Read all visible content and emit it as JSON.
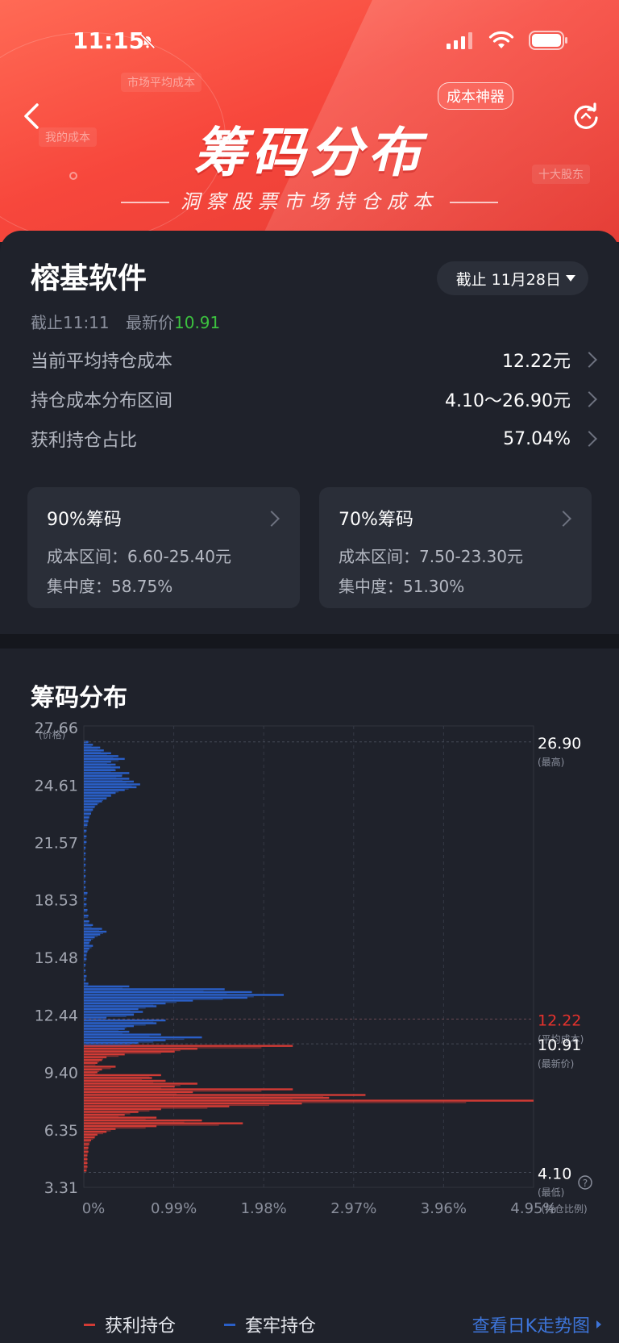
{
  "status_bar": {
    "time": "11:15"
  },
  "header": {
    "title": "筹码分布",
    "subtitle": "洞察股票市场持仓成本",
    "badge": "成本神器",
    "ghost_labels": [
      "市场平均成本",
      "我的成本",
      "十大股东"
    ]
  },
  "stock": {
    "name": "榕基软件",
    "date_selector": "截止 11月28日",
    "as_of_label": "截止11:11",
    "latest_price_label": "最新价",
    "latest_price": "10.91"
  },
  "metrics": [
    {
      "label": "当前平均持仓成本",
      "value": "12.22元"
    },
    {
      "label": "持仓成本分布区间",
      "value": "4.10～26.90元"
    },
    {
      "label": "获利持仓占比",
      "value": "57.04%"
    }
  ],
  "concentration": [
    {
      "title": "90%筹码",
      "range": "成本区间：6.60-25.40元",
      "degree": "集中度：58.75%"
    },
    {
      "title": "70%筹码",
      "range": "成本区间：7.50-23.30元",
      "degree": "集中度：51.30%"
    }
  ],
  "chart_section_title": "筹码分布",
  "chart_data": {
    "type": "bar",
    "orientation": "horizontal",
    "y_axis_label": "(价格)",
    "x_axis_label": "(持仓比例)",
    "y_ticks": [
      "27.66",
      "24.61",
      "21.57",
      "18.53",
      "15.48",
      "12.44",
      "9.40",
      "6.35",
      "3.31"
    ],
    "x_ticks": [
      "0%",
      "0.99%",
      "1.98%",
      "2.97%",
      "3.96%",
      "4.95%"
    ],
    "ylim": [
      3.31,
      27.66
    ],
    "xlim": [
      0,
      4.95
    ],
    "markers": [
      {
        "value": "26.90",
        "note": "(最高)",
        "price": 26.9,
        "color": "#ffffff"
      },
      {
        "value": "12.22",
        "note": "(平均成本)",
        "price": 12.22,
        "color": "#e5322d"
      },
      {
        "value": "10.91",
        "note": "(最新价)",
        "price": 10.91,
        "color": "#ffffff"
      },
      {
        "value": "4.10",
        "note": "(最低)",
        "price": 4.1,
        "color": "#ffffff"
      }
    ],
    "series": [
      {
        "name": "获利持仓",
        "color": "#d23b35",
        "price_range": [
          4.1,
          10.91
        ],
        "points": [
          [
            10.8,
            2.3
          ],
          [
            10.65,
            1.25
          ],
          [
            10.5,
            1.0
          ],
          [
            10.35,
            0.45
          ],
          [
            10.2,
            0.25
          ],
          [
            10.05,
            0.2
          ],
          [
            9.9,
            0.15
          ],
          [
            9.7,
            0.35
          ],
          [
            9.55,
            0.2
          ],
          [
            9.4,
            0.15
          ],
          [
            9.25,
            0.85
          ],
          [
            9.1,
            0.75
          ],
          [
            8.95,
            0.9
          ],
          [
            8.8,
            1.25
          ],
          [
            8.65,
            1.0
          ],
          [
            8.5,
            2.3
          ],
          [
            8.35,
            1.2
          ],
          [
            8.2,
            3.1
          ],
          [
            8.05,
            2.7
          ],
          [
            7.9,
            4.95
          ],
          [
            7.75,
            2.4
          ],
          [
            7.6,
            1.6
          ],
          [
            7.45,
            0.85
          ],
          [
            7.3,
            0.6
          ],
          [
            7.15,
            0.45
          ],
          [
            7.0,
            0.8
          ],
          [
            6.85,
            1.3
          ],
          [
            6.7,
            1.75
          ],
          [
            6.55,
            0.8
          ],
          [
            6.4,
            0.35
          ],
          [
            6.25,
            0.25
          ],
          [
            6.1,
            0.15
          ],
          [
            5.95,
            0.12
          ],
          [
            5.8,
            0.08
          ],
          [
            5.6,
            0.06
          ],
          [
            5.4,
            0.05
          ],
          [
            5.2,
            0.05
          ],
          [
            5.0,
            0.04
          ],
          [
            4.8,
            0.04
          ],
          [
            4.6,
            0.04
          ],
          [
            4.4,
            0.04
          ],
          [
            4.2,
            0.03
          ]
        ]
      },
      {
        "name": "套牢持仓",
        "color": "#2a5fc7",
        "price_range": [
          10.91,
          26.9
        ],
        "points": [
          [
            26.9,
            0.05
          ],
          [
            26.75,
            0.1
          ],
          [
            26.6,
            0.18
          ],
          [
            26.45,
            0.22
          ],
          [
            26.3,
            0.3
          ],
          [
            26.15,
            0.38
          ],
          [
            26.0,
            0.45
          ],
          [
            25.85,
            0.3
          ],
          [
            25.7,
            0.35
          ],
          [
            25.55,
            0.4
          ],
          [
            25.4,
            0.35
          ],
          [
            25.25,
            0.5
          ],
          [
            25.1,
            0.42
          ],
          [
            24.95,
            0.5
          ],
          [
            24.8,
            0.55
          ],
          [
            24.65,
            0.62
          ],
          [
            24.5,
            0.58
          ],
          [
            24.35,
            0.45
          ],
          [
            24.2,
            0.35
          ],
          [
            24.05,
            0.3
          ],
          [
            23.9,
            0.25
          ],
          [
            23.75,
            0.2
          ],
          [
            23.6,
            0.15
          ],
          [
            23.45,
            0.12
          ],
          [
            23.3,
            0.1
          ],
          [
            23.1,
            0.08
          ],
          [
            22.9,
            0.06
          ],
          [
            22.7,
            0.05
          ],
          [
            22.5,
            0.04
          ],
          [
            22.2,
            0.03
          ],
          [
            21.9,
            0.03
          ],
          [
            21.6,
            0.03
          ],
          [
            21.3,
            0.02
          ],
          [
            21.0,
            0.02
          ],
          [
            20.7,
            0.02
          ],
          [
            20.4,
            0.02
          ],
          [
            20.1,
            0.02
          ],
          [
            19.8,
            0.02
          ],
          [
            19.5,
            0.02
          ],
          [
            19.2,
            0.02
          ],
          [
            18.9,
            0.04
          ],
          [
            18.6,
            0.03
          ],
          [
            18.3,
            0.03
          ],
          [
            18.0,
            0.04
          ],
          [
            17.7,
            0.05
          ],
          [
            17.4,
            0.06
          ],
          [
            17.2,
            0.1
          ],
          [
            17.0,
            0.2
          ],
          [
            16.85,
            0.25
          ],
          [
            16.7,
            0.18
          ],
          [
            16.55,
            0.12
          ],
          [
            16.4,
            0.08
          ],
          [
            16.25,
            0.06
          ],
          [
            16.1,
            0.1
          ],
          [
            15.95,
            0.06
          ],
          [
            15.8,
            0.04
          ],
          [
            15.6,
            0.03
          ],
          [
            15.4,
            0.03
          ],
          [
            15.1,
            0.02
          ],
          [
            14.8,
            0.02
          ],
          [
            14.5,
            0.03
          ],
          [
            14.3,
            0.02
          ],
          [
            14.1,
            0.05
          ],
          [
            13.95,
            0.5
          ],
          [
            13.8,
            1.55
          ],
          [
            13.65,
            1.85
          ],
          [
            13.5,
            2.2
          ],
          [
            13.35,
            1.8
          ],
          [
            13.2,
            1.2
          ],
          [
            13.05,
            0.9
          ],
          [
            12.9,
            0.8
          ],
          [
            12.75,
            0.6
          ],
          [
            12.6,
            0.65
          ],
          [
            12.45,
            0.55
          ],
          [
            12.3,
            0.25
          ],
          [
            12.15,
            0.9
          ],
          [
            12.0,
            0.8
          ],
          [
            11.85,
            0.55
          ],
          [
            11.7,
            0.45
          ],
          [
            11.55,
            0.5
          ],
          [
            11.4,
            0.85
          ],
          [
            11.25,
            1.3
          ],
          [
            11.1,
            0.9
          ],
          [
            10.95,
            0.6
          ]
        ]
      }
    ]
  },
  "legend": [
    {
      "label": "获利持仓",
      "color": "#d23b35"
    },
    {
      "label": "套牢持仓",
      "color": "#2a5fc7"
    }
  ],
  "k_link": "查看日K走势图",
  "colors": {
    "profit": "#d23b35",
    "trapped": "#2a5fc7",
    "price_up": "#3cc23f",
    "avg_cost": "#e5322d",
    "link": "#3d74d8"
  }
}
